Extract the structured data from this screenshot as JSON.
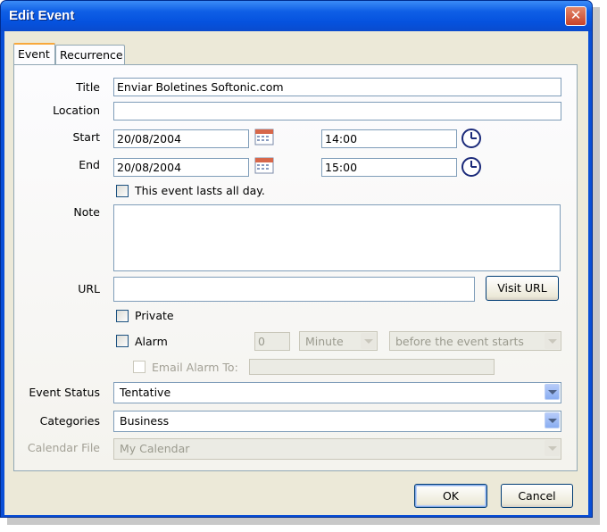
{
  "window": {
    "title": "Edit Event",
    "close_glyph": "✕"
  },
  "tabs": [
    {
      "label": "Event"
    },
    {
      "label": "Recurrence"
    }
  ],
  "labels": {
    "title": "Title",
    "location": "Location",
    "start": "Start",
    "end": "End",
    "note": "Note",
    "url": "URL",
    "event_status": "Event Status",
    "categories": "Categories",
    "calendar_file": "Calendar File"
  },
  "fields": {
    "title": "Enviar Boletines Softonic.com",
    "location": "",
    "start_date": "20/08/2004",
    "start_time": "14:00",
    "end_date": "20/08/2004",
    "end_time": "15:00",
    "note": "",
    "url": ""
  },
  "checkboxes": {
    "all_day": "This event lasts all day.",
    "private": "Private",
    "alarm": "Alarm",
    "email_alarm": "Email Alarm To:"
  },
  "alarm": {
    "amount": "0",
    "unit": "Minute",
    "relation": "before the event starts",
    "email": ""
  },
  "selects": {
    "event_status": "Tentative",
    "categories": "Business",
    "calendar_file": "My Calendar"
  },
  "buttons": {
    "visit_url": "Visit URL",
    "ok": "OK",
    "cancel": "Cancel"
  },
  "icons": {
    "calendar": "calendar-icon",
    "clock": "clock-icon",
    "dropdown": "chevron-down-icon"
  },
  "colors": {
    "titlebar": "#0a4fd6",
    "dialog_bg": "#ece9d8",
    "close_button": "#c7422a",
    "tab_highlight": "#f8a83c"
  }
}
